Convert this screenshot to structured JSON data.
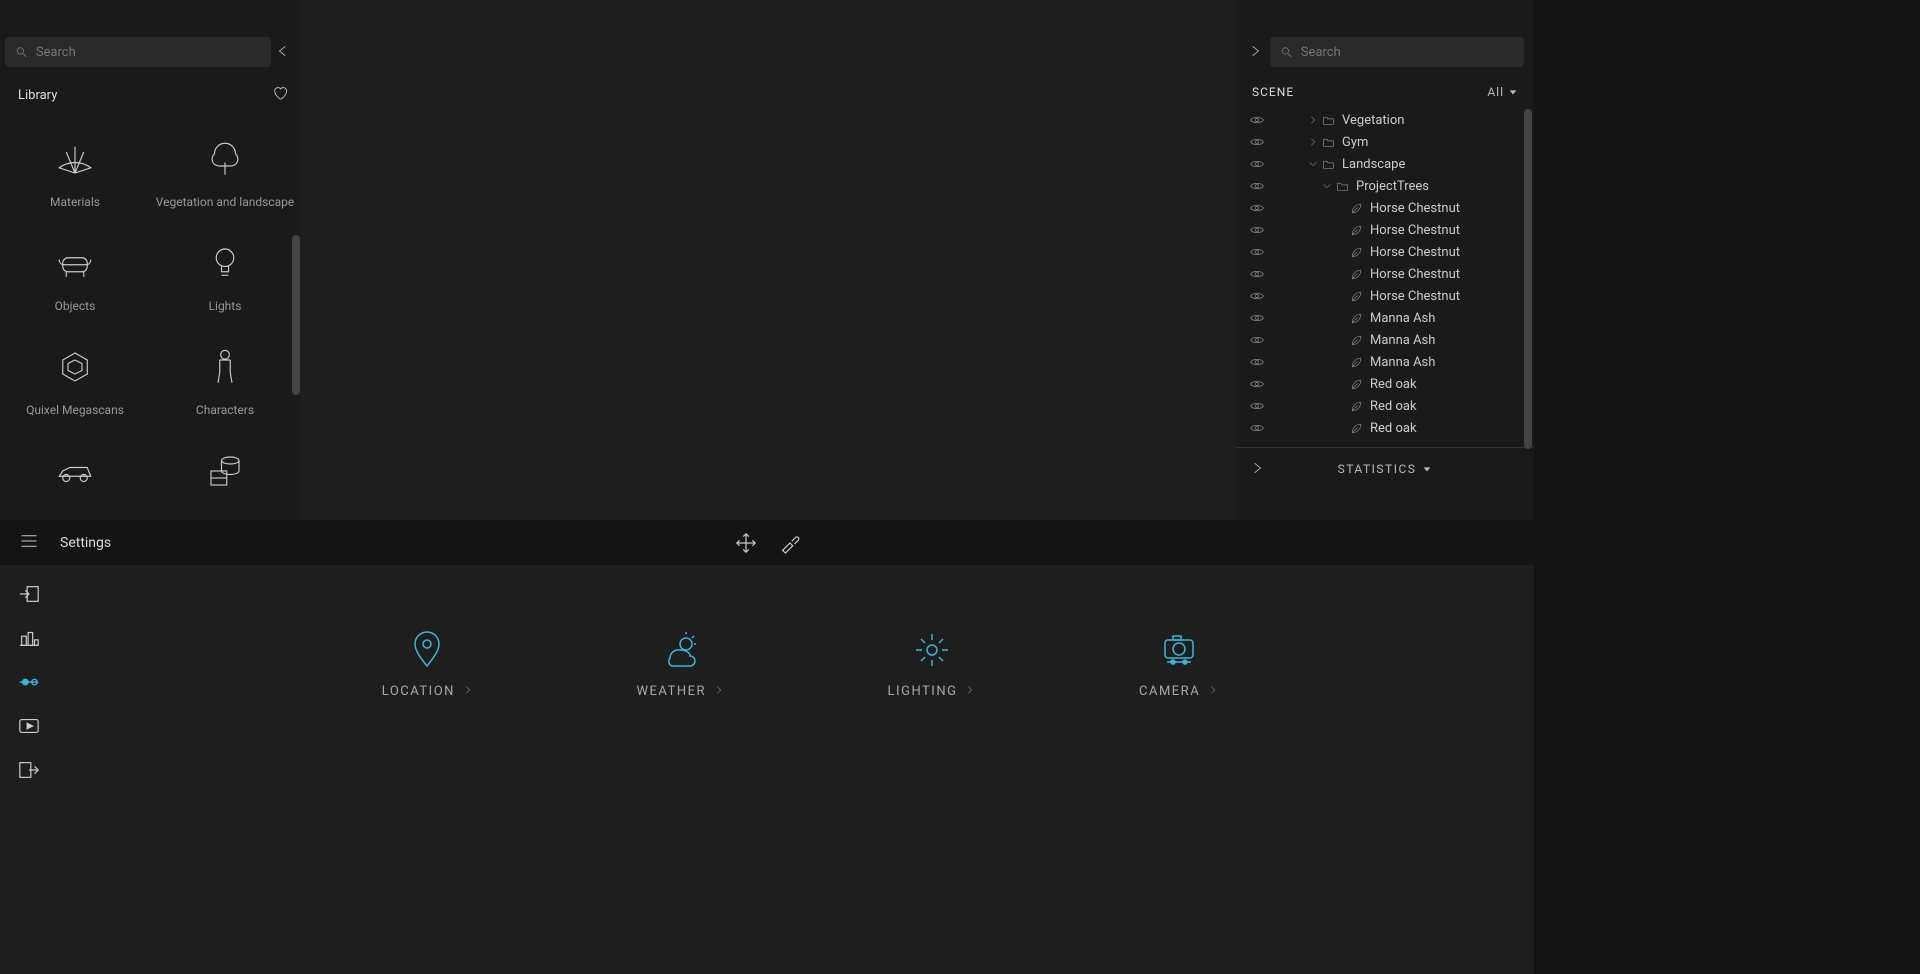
{
  "left": {
    "search_placeholder": "Search",
    "library_label": "Library",
    "items": [
      {
        "label": "Materials",
        "name": "materials"
      },
      {
        "label": "Vegetation and landscape",
        "name": "vegetation"
      },
      {
        "label": "Objects",
        "name": "objects"
      },
      {
        "label": "Lights",
        "name": "lights"
      },
      {
        "label": "Quixel Megascans",
        "name": "megascans"
      },
      {
        "label": "Characters",
        "name": "characters"
      },
      {
        "label": "",
        "name": "vehicle"
      },
      {
        "label": "",
        "name": "bricks"
      }
    ]
  },
  "settings": {
    "label": "Settings"
  },
  "bottom": {
    "categories": [
      {
        "label": "LOCATION",
        "name": "location"
      },
      {
        "label": "WEATHER",
        "name": "weather"
      },
      {
        "label": "LIGHTING",
        "name": "lighting"
      },
      {
        "label": "CAMERA",
        "name": "camera"
      }
    ]
  },
  "right": {
    "search_placeholder": "Search",
    "scene_label": "SCENE",
    "all_label": "All",
    "stats_label": "STATISTICS",
    "tree": [
      {
        "type": "folder",
        "label": "Vegetation",
        "depth": 0,
        "toggle": "closed"
      },
      {
        "type": "folder",
        "label": "Gym",
        "depth": 0,
        "toggle": "closed"
      },
      {
        "type": "folder",
        "label": "Landscape",
        "depth": 0,
        "toggle": "open"
      },
      {
        "type": "folder",
        "label": "ProjectTrees",
        "depth": 1,
        "toggle": "open"
      },
      {
        "type": "leaf",
        "label": "Horse Chestnut",
        "depth": 2
      },
      {
        "type": "leaf",
        "label": "Horse Chestnut",
        "depth": 2
      },
      {
        "type": "leaf",
        "label": "Horse Chestnut",
        "depth": 2
      },
      {
        "type": "leaf",
        "label": "Horse Chestnut",
        "depth": 2
      },
      {
        "type": "leaf",
        "label": "Horse Chestnut",
        "depth": 2
      },
      {
        "type": "leaf",
        "label": "Manna Ash",
        "depth": 2
      },
      {
        "type": "leaf",
        "label": "Manna Ash",
        "depth": 2
      },
      {
        "type": "leaf",
        "label": "Manna Ash",
        "depth": 2
      },
      {
        "type": "leaf",
        "label": "Red oak",
        "depth": 2
      },
      {
        "type": "leaf",
        "label": "Red oak",
        "depth": 2
      },
      {
        "type": "leaf",
        "label": "Red oak",
        "depth": 2
      }
    ]
  }
}
